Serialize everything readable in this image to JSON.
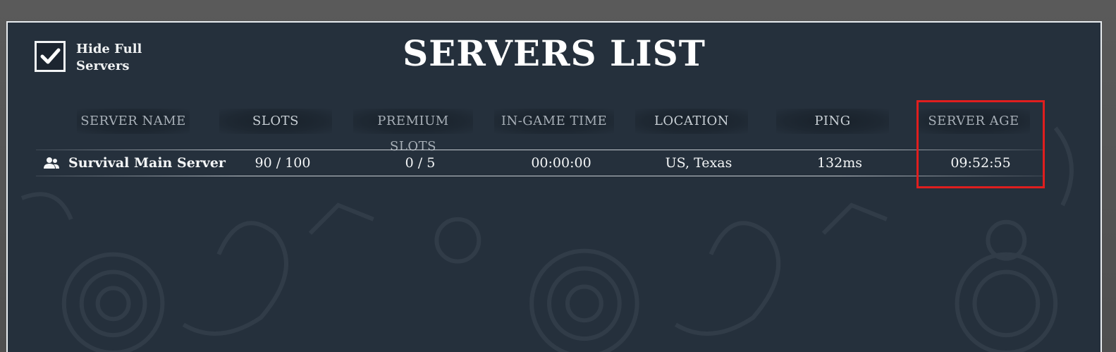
{
  "filter": {
    "hide_full_label": "Hide Full Servers",
    "checked": true
  },
  "title": "SERVERS LIST",
  "columns": [
    "SERVER NAME",
    "SLOTS",
    "PREMIUM SLOTS",
    "IN-GAME TIME",
    "LOCATION",
    "PING",
    "SERVER AGE"
  ],
  "servers": [
    {
      "name": "Survival Main Server",
      "slots": "90 / 100",
      "premium_slots": "0 / 5",
      "in_game_time": "00:00:00",
      "location": "US, Texas",
      "ping": "132ms",
      "server_age": "09:52:55"
    }
  ],
  "colors": {
    "panel_bg": "#25303c",
    "highlight": "#e01e1e",
    "text": "#f4f6f7",
    "header_text": "#c9d0d6"
  },
  "icons": {
    "checkbox": "checkmark-icon",
    "server_row": "users-icon"
  }
}
